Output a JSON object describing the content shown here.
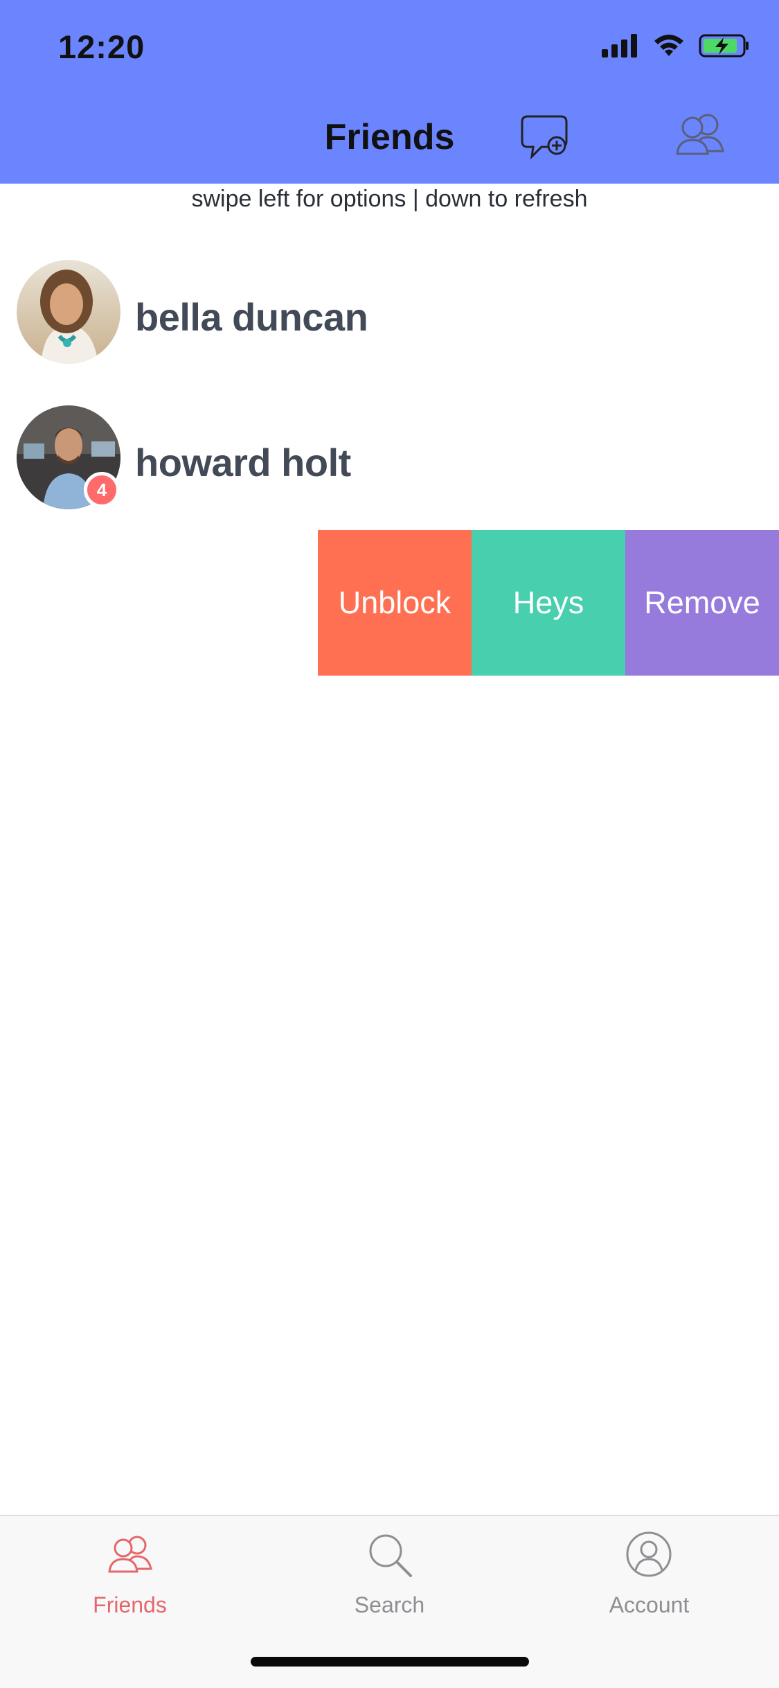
{
  "status_bar": {
    "time": "12:20"
  },
  "header": {
    "title": "Friends"
  },
  "hint": "swipe left for options | down to refresh",
  "friends": [
    {
      "name": "bella duncan"
    },
    {
      "name": "howard holt",
      "badge": "4"
    }
  ],
  "swipe_actions": [
    {
      "label": "Unblock",
      "color": "#ff6f52"
    },
    {
      "label": "Heys",
      "color": "#48cfad"
    },
    {
      "label": "Remove",
      "color": "#967adc"
    }
  ],
  "tabbar": {
    "tabs": [
      {
        "label": "Friends",
        "icon": "friends-icon",
        "active": true
      },
      {
        "label": "Search",
        "icon": "search-icon",
        "active": false
      },
      {
        "label": "Account",
        "icon": "account-icon",
        "active": false
      }
    ]
  },
  "colors": {
    "header": "#6b85ff",
    "active_tab": "#e5676b",
    "inactive_tab": "#8e8e93",
    "badge": "#ff6b6b"
  }
}
